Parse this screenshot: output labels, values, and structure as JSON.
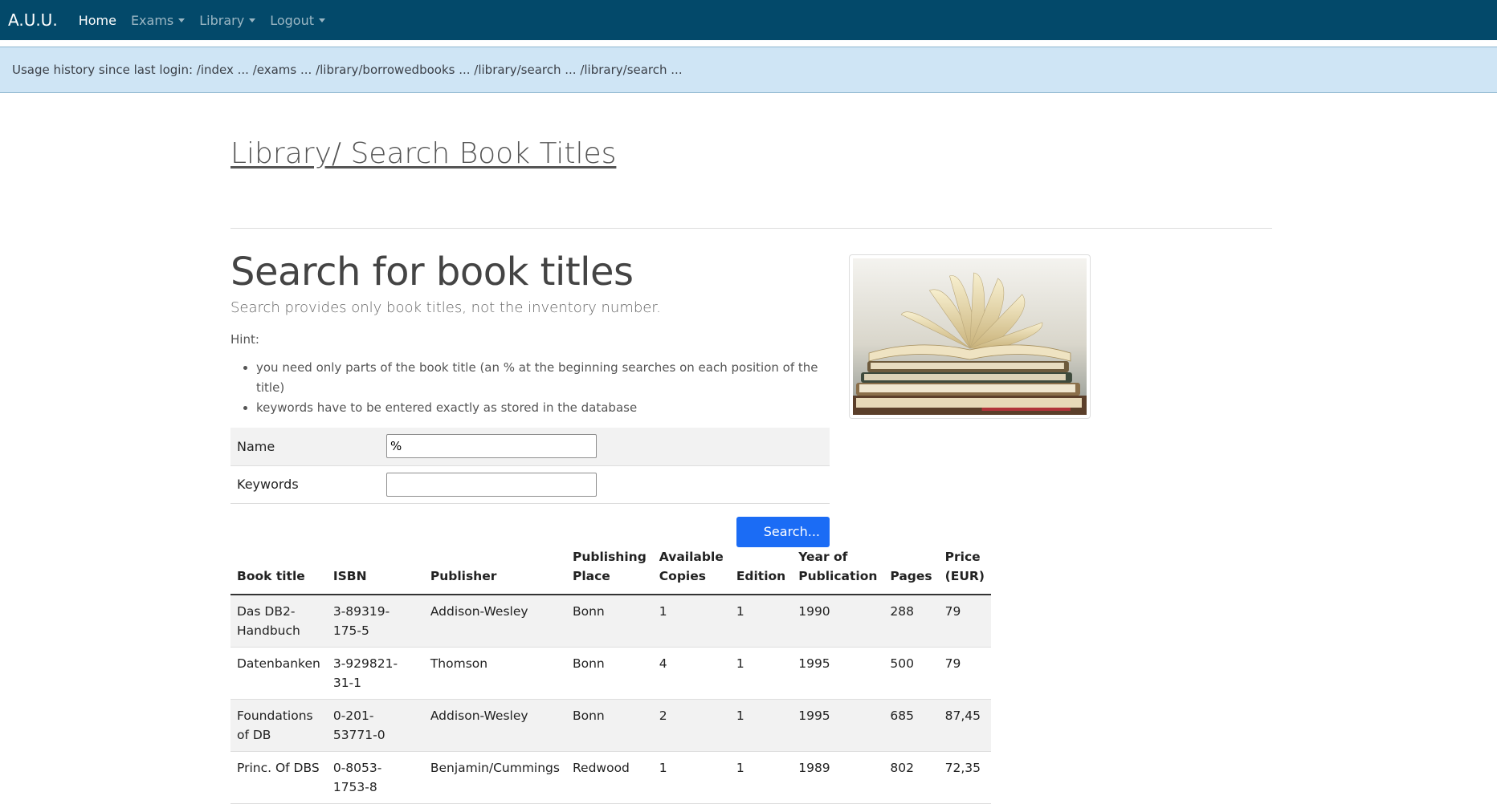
{
  "nav": {
    "brand": "A.U.U.",
    "items": [
      {
        "label": "Home",
        "active": true,
        "dropdown": false
      },
      {
        "label": "Exams",
        "active": false,
        "dropdown": true
      },
      {
        "label": "Library",
        "active": false,
        "dropdown": true
      },
      {
        "label": "Logout",
        "active": false,
        "dropdown": true
      }
    ]
  },
  "history": {
    "text": "Usage history since last login: /index ... /exams ... /library/borrowedbooks ... /library/search ... /library/search ..."
  },
  "page": {
    "title": "Library/ Search Book Titles",
    "heading": "Search for book titles",
    "lead": "Search provides only book titles, not the inventory number.",
    "hint_label": "Hint:",
    "hints": [
      "you need only parts of the book title (an % at the beginning searches on each position of the title)",
      "keywords have to be entered exactly as stored in the database"
    ]
  },
  "form": {
    "name_label": "Name",
    "name_value": "%",
    "keywords_label": "Keywords",
    "keywords_value": "",
    "search_button": "Search..."
  },
  "results": {
    "headers": [
      "Book title",
      "ISBN",
      "Publisher",
      "Publishing Place",
      "Available Copies",
      "Edition",
      "Year of Publication",
      "Pages",
      "Price (EUR)"
    ],
    "rows": [
      [
        "Das DB2-Handbuch",
        "3-89319-175-5",
        "Addison-Wesley",
        "Bonn",
        "1",
        "1",
        "1990",
        "288",
        "79"
      ],
      [
        "Datenbanken",
        "3-929821-31-1",
        "Thomson",
        "Bonn",
        "4",
        "1",
        "1995",
        "500",
        "79"
      ],
      [
        "Foundations of DB",
        "0-201-53771-0",
        "Addison-Wesley",
        "Bonn",
        "2",
        "1",
        "1995",
        "685",
        "87,45"
      ],
      [
        "Princ. Of DBS",
        "0-8053-1753-8",
        "Benjamin/Cummings",
        "Redwood",
        "1",
        "1",
        "1989",
        "802",
        "72,35"
      ]
    ]
  },
  "colors": {
    "navbar": "#03496a",
    "history_bg": "#cfe5f5",
    "button": "#1b6cf5"
  },
  "image": {
    "icon": "open-books-photo"
  }
}
